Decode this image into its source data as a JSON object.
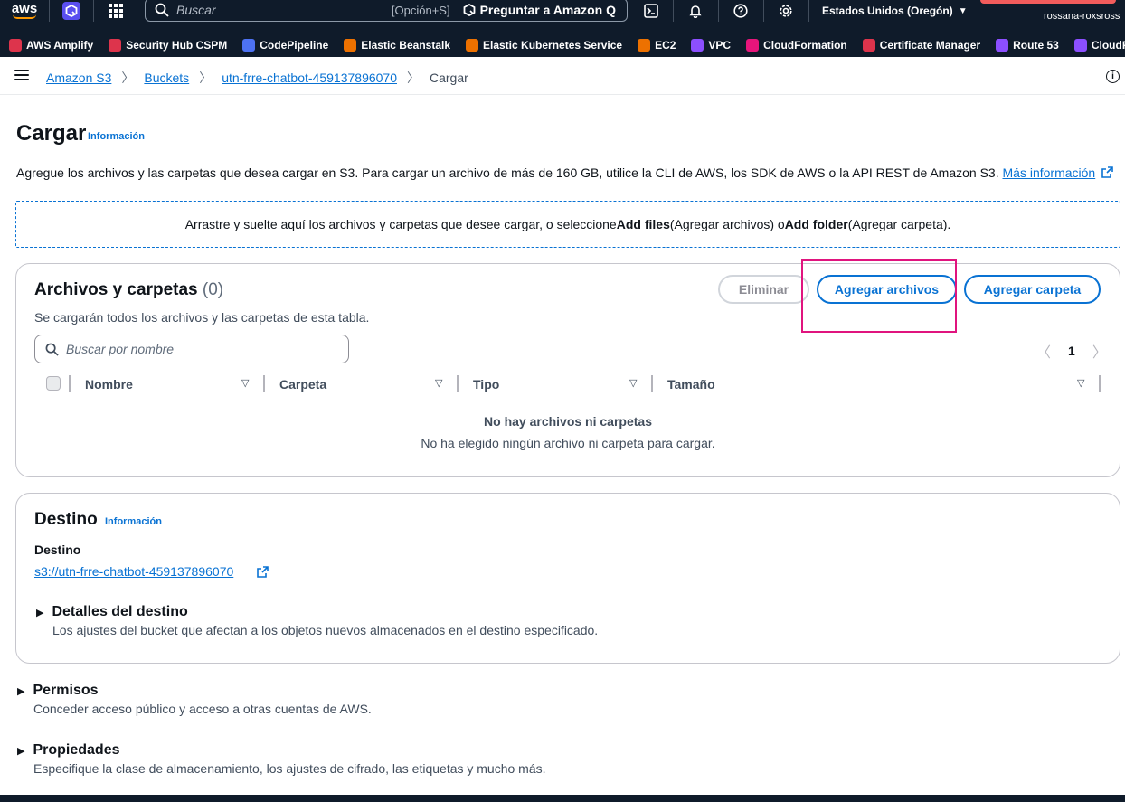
{
  "topnav": {
    "logo": "aws",
    "search_placeholder": "Buscar",
    "search_shortcut": "[Opción+S]",
    "ask_q_label": "Preguntar a Amazon Q",
    "region": "Estados Unidos (Oregón)",
    "account_user": "rossana-roxsross"
  },
  "favorites": [
    {
      "label": "AWS Amplify",
      "color": "#dd344c"
    },
    {
      "label": "Security Hub CSPM",
      "color": "#dd344c"
    },
    {
      "label": "CodePipeline",
      "color": "#4d72f3"
    },
    {
      "label": "Elastic Beanstalk",
      "color": "#ed7100"
    },
    {
      "label": "Elastic Kubernetes Service",
      "color": "#ed7100"
    },
    {
      "label": "EC2",
      "color": "#ed7100"
    },
    {
      "label": "VPC",
      "color": "#8c4fff"
    },
    {
      "label": "CloudFormation",
      "color": "#e7157b"
    },
    {
      "label": "Certificate Manager",
      "color": "#dd344c"
    },
    {
      "label": "Route 53",
      "color": "#8c4fff"
    },
    {
      "label": "CloudFront",
      "color": "#8c4fff"
    }
  ],
  "breadcrumb": {
    "items": [
      "Amazon S3",
      "Buckets",
      "utn-frre-chatbot-459137896070"
    ],
    "current": "Cargar"
  },
  "page": {
    "title": "Cargar",
    "info": "Información",
    "description": "Agregue los archivos y las carpetas que desea cargar en S3. Para cargar un archivo de más de 160 GB, utilice la CLI de AWS, los SDK de AWS o la API REST de Amazon S3.",
    "more_info": "Más información",
    "dropzone": {
      "pre": "Arrastre y suelte aquí los archivos y carpetas que desee cargar, o seleccione ",
      "add_files": "Add files",
      "mid": " (Agregar archivos) o ",
      "add_folder": "Add folder",
      "post": " (Agregar carpeta)."
    }
  },
  "files": {
    "title": "Archivos y carpetas",
    "count": "(0)",
    "subtitle": "Se cargarán todos los archivos y las carpetas de esta tabla.",
    "delete_label": "Eliminar",
    "add_files_label": "Agregar archivos",
    "add_folder_label": "Agregar carpeta",
    "search_placeholder": "Buscar por nombre",
    "page": "1",
    "columns": [
      "Nombre",
      "Carpeta",
      "Tipo",
      "Tamaño"
    ],
    "empty_title": "No hay archivos ni carpetas",
    "empty_sub": "No ha elegido ningún archivo ni carpeta para cargar."
  },
  "destination": {
    "title": "Destino",
    "info": "Información",
    "label": "Destino",
    "uri": "s3://utn-frre-chatbot-459137896070",
    "details_title": "Detalles del destino",
    "details_desc": "Los ajustes del bucket que afectan a los objetos nuevos almacenados en el destino especificado."
  },
  "permissions": {
    "title": "Permisos",
    "desc": "Conceder acceso público y acceso a otras cuentas de AWS."
  },
  "properties": {
    "title": "Propiedades",
    "desc": "Especifique la clase de almacenamiento, los ajustes de cifrado, las etiquetas y mucho más."
  }
}
